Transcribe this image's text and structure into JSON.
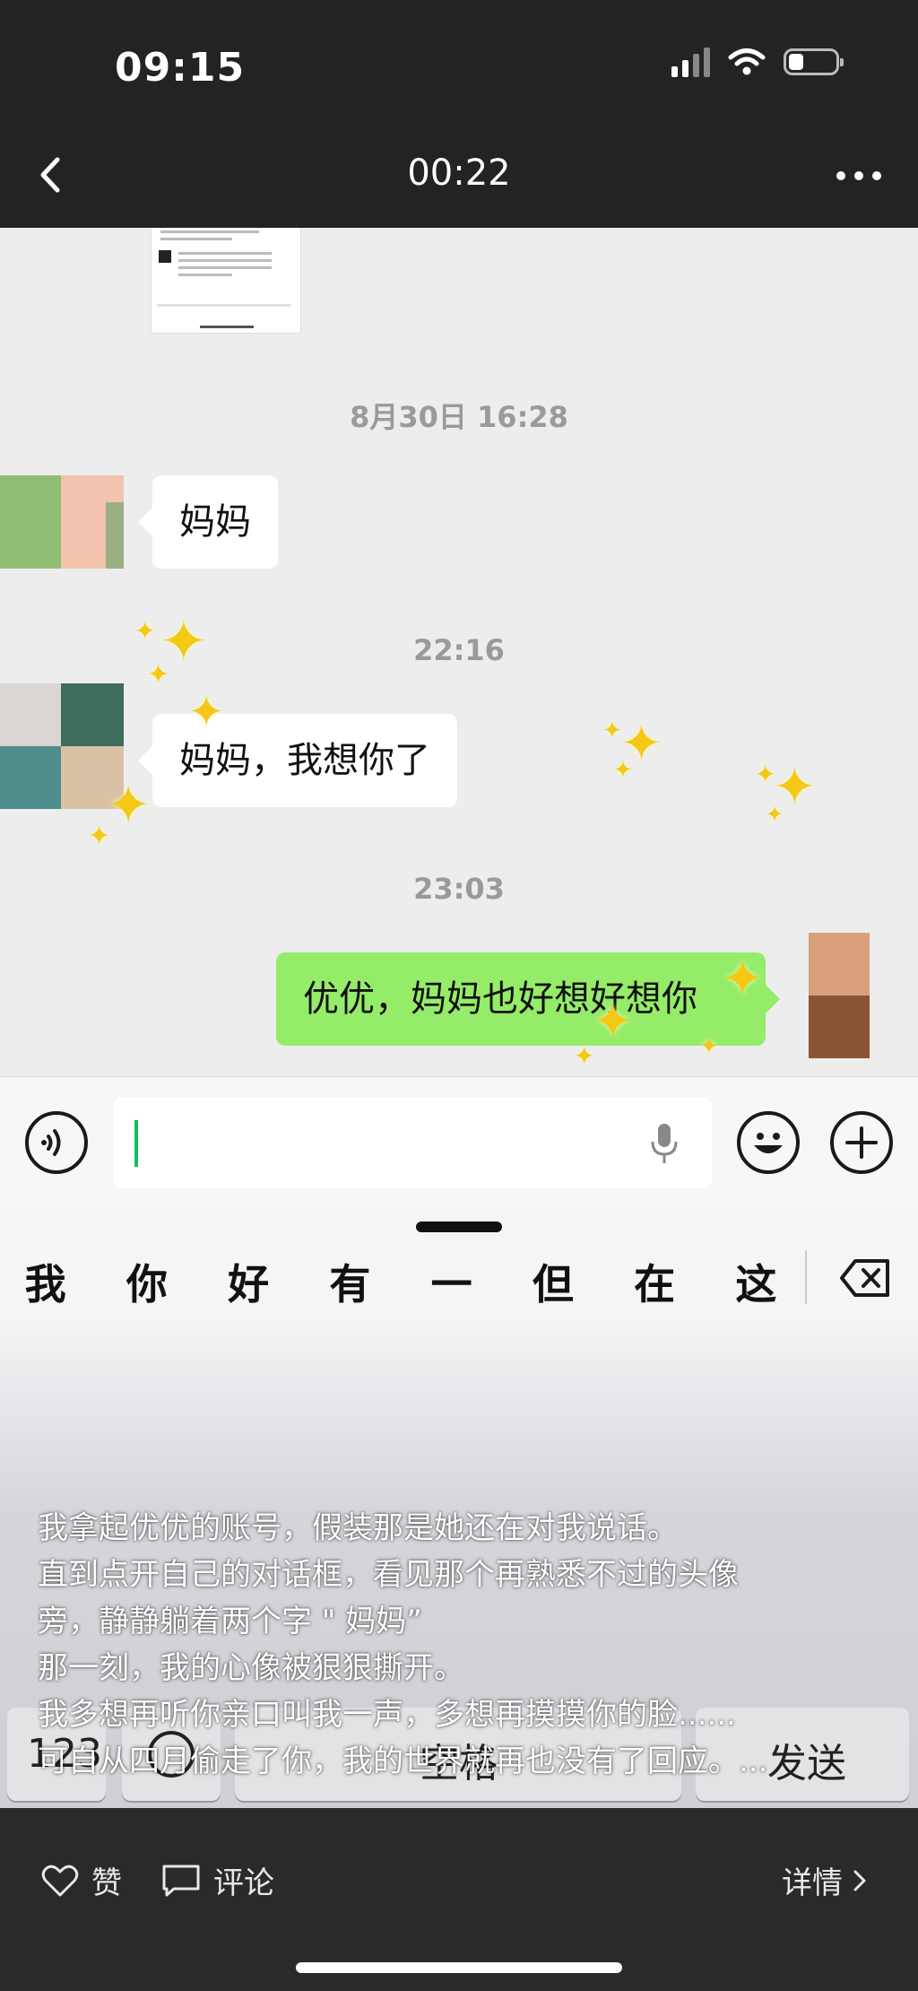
{
  "status_bar": {
    "time": "09:15"
  },
  "nav": {
    "title": "00:22"
  },
  "chat": {
    "messages": [
      {
        "type": "timestamp",
        "text": "8月30日 16:28"
      },
      {
        "type": "incoming",
        "text": "妈妈"
      },
      {
        "type": "timestamp",
        "text": "22:16"
      },
      {
        "type": "incoming",
        "text": "妈妈，我想你了"
      },
      {
        "type": "timestamp",
        "text": "23:03"
      },
      {
        "type": "outgoing",
        "text": "优优，妈妈也好想好想你"
      }
    ]
  },
  "keyboard": {
    "candidates": [
      "我",
      "你",
      "好",
      "有",
      "一",
      "但",
      "在",
      "这"
    ],
    "bottom_keys": {
      "num": "123",
      "space": "空格",
      "send": "发送"
    }
  },
  "caption": {
    "lines": [
      "我拿起优优的账号，假装那是她还在对我说话。",
      "直到点开自己的对话框，看见那个再熟悉不过的头像",
      "旁，静静躺着两个字 \" 妈妈”",
      "那一刻，我的心像被狠狠撕开。",
      "我多想再听你亲口叫我一声，多想再摸摸你的脸......",
      "可自从四月偷走了你，我的世界就再也没有了回应。..."
    ]
  },
  "footer": {
    "like": "赞",
    "comment": "评论",
    "details": "详情"
  },
  "colors": {
    "outgoing_bubble": "#95ec69",
    "top_bar": "#232323",
    "cursor": "#07c160",
    "sparkle": "#f5c816"
  }
}
